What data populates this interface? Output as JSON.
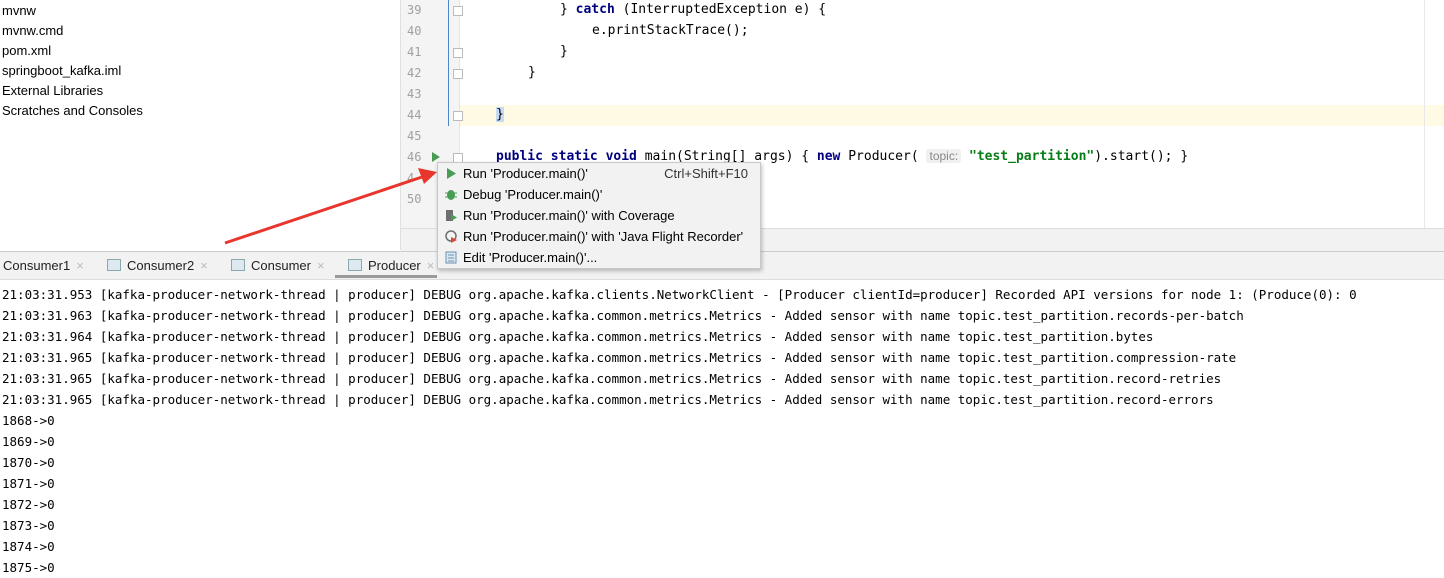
{
  "project_tree": {
    "items": [
      "mvnw",
      "mvnw.cmd",
      "pom.xml",
      "springboot_kafka.iml",
      "External Libraries",
      "Scratches and Consoles"
    ],
    "visible_text": [
      "vnw",
      "vnw.cmd",
      "om.xml",
      "pringboot_kafka.iml",
      "rnal Libraries",
      "tches and Consoles"
    ]
  },
  "editor": {
    "line_numbers": [
      "39",
      "40",
      "41",
      "42",
      "43",
      "44",
      "45",
      "46",
      "4",
      "50"
    ],
    "code": {
      "l39a": "} ",
      "l39kw": "catch",
      "l39b": " (InterruptedException e) {",
      "l40": "e.printStackTrace();",
      "l41": "}",
      "l42": "}",
      "l44": "}",
      "l46kw1": "public static void",
      "l46a": " main(String[] args) { ",
      "l46kw2": "new",
      "l46b": " Producer( ",
      "l46hint": "topic:",
      "l46str": "\"test_partition\"",
      "l46c": ").start(); }"
    }
  },
  "context_menu": {
    "items": [
      {
        "label": "Run 'Producer.main()'",
        "shortcut": "Ctrl+Shift+F10",
        "icon": "run-icon"
      },
      {
        "label": "Debug 'Producer.main()'",
        "icon": "debug-icon"
      },
      {
        "label": "Run 'Producer.main()' with Coverage",
        "icon": "coverage-icon"
      },
      {
        "label": "Run 'Producer.main()' with 'Java Flight Recorder'",
        "icon": "profiler-icon"
      },
      {
        "label": "Edit 'Producer.main()'...",
        "icon": "edit-config-icon"
      }
    ]
  },
  "run_tabs": [
    {
      "label": "Consumer1"
    },
    {
      "label": "Consumer2"
    },
    {
      "label": "Consumer"
    },
    {
      "label": "Producer",
      "active": true
    }
  ],
  "console": {
    "lines": [
      "21:03:31.953 [kafka-producer-network-thread | producer] DEBUG org.apache.kafka.clients.NetworkClient - [Producer clientId=producer] Recorded API versions for node 1: (Produce(0): 0",
      "21:03:31.963 [kafka-producer-network-thread | producer] DEBUG org.apache.kafka.common.metrics.Metrics - Added sensor with name topic.test_partition.records-per-batch",
      "21:03:31.964 [kafka-producer-network-thread | producer] DEBUG org.apache.kafka.common.metrics.Metrics - Added sensor with name topic.test_partition.bytes",
      "21:03:31.965 [kafka-producer-network-thread | producer] DEBUG org.apache.kafka.common.metrics.Metrics - Added sensor with name topic.test_partition.compression-rate",
      "21:03:31.965 [kafka-producer-network-thread | producer] DEBUG org.apache.kafka.common.metrics.Metrics - Added sensor with name topic.test_partition.record-retries",
      "21:03:31.965 [kafka-producer-network-thread | producer] DEBUG org.apache.kafka.common.metrics.Metrics - Added sensor with name topic.test_partition.record-errors",
      "1868->0",
      "1869->0",
      "1870->0",
      "1871->0",
      "1872->0",
      "1873->0",
      "1874->0",
      "1875->0"
    ]
  },
  "colors": {
    "annotation_arrow": "#e8362c",
    "run_green": "#499c54",
    "current_line": "#fffae3"
  }
}
